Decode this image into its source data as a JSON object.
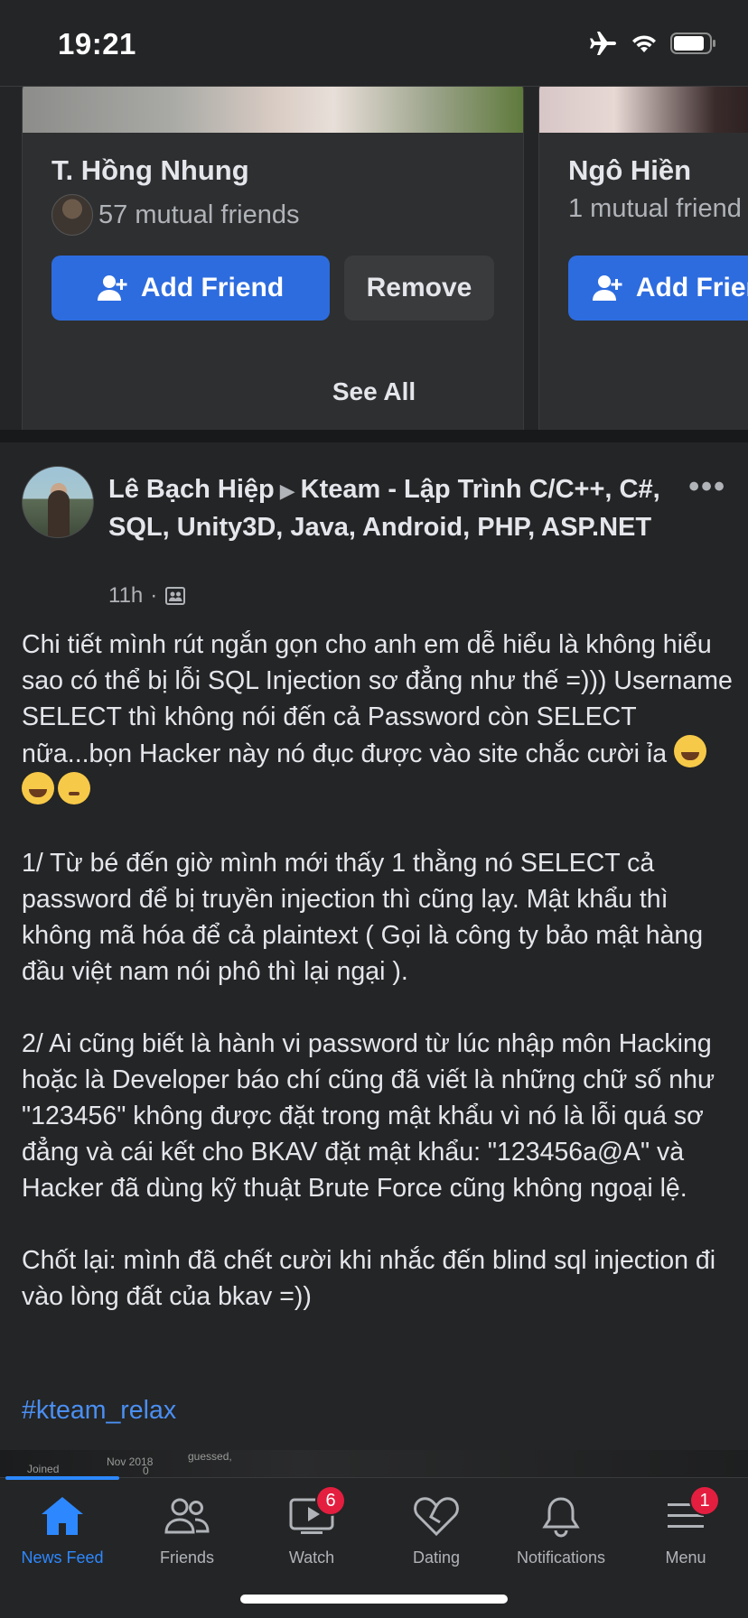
{
  "status_bar": {
    "time": "19:21"
  },
  "suggestions": {
    "cards": [
      {
        "name": "T. Hồng Nhung",
        "mutual": "57 mutual friends",
        "add_label": "Add Friend",
        "remove_label": "Remove"
      },
      {
        "name": "Ngô Hiền",
        "mutual": "1 mutual friend",
        "add_label": "Add Friend"
      }
    ],
    "see_all": "See All"
  },
  "post": {
    "author": "Lê Bạch Hiệp",
    "group": "Kteam - Lập Trình C/C++, C#, SQL, Unity3D, Java, Android, PHP, ASP.NET",
    "time": "11h",
    "more_icon": "more-dots-icon",
    "paragraphs": [
      "Chi tiết mình rút ngắn gọn cho anh em dễ hiểu là không hiểu sao có thể bị lỗi SQL Injection sơ đẳng như thế =))) Username SELECT thì không nói đến cả Password còn SELECT nữa...bọn Hacker này nó đục được vào site chắc cười ỉa",
      "1/ Từ bé đến giờ mình mới thấy 1 thằng nó SELECT cả password để bị truyền injection thì cũng lạy. Mật khẩu thì không mã hóa để cả plaintext ( Gọi là công ty bảo mật hàng đầu việt nam nói phô thì lại ngại ).",
      "2/ Ai cũng biết là hành vi password từ lúc nhập môn Hacking hoặc là Developer báo chí cũng đã viết là những chữ số như \"123456\" không được đặt trong mật khẩu vì nó là lỗi quá sơ đẳng và cái kết cho BKAV đặt mật khẩu: \"123456a@A\" và Hacker đã dùng kỹ thuật Brute Force cũng không ngoại lệ.",
      "Chốt lại: mình đã chết cười khi nhắc đến blind sql injection đi vào lòng đất của bkav =))"
    ],
    "hashtag": "#kteam_relax",
    "image_peek_texts": [
      "Joined",
      "Nov 2018",
      "guessed,",
      "0"
    ]
  },
  "tabbar": {
    "tabs": [
      {
        "label": "News Feed",
        "icon": "home-icon",
        "active": true
      },
      {
        "label": "Friends",
        "icon": "friends-icon"
      },
      {
        "label": "Watch",
        "icon": "watch-icon",
        "badge": "6"
      },
      {
        "label": "Dating",
        "icon": "dating-icon"
      },
      {
        "label": "Notifications",
        "icon": "bell-icon"
      },
      {
        "label": "Menu",
        "icon": "menu-icon",
        "badge": "1"
      }
    ]
  },
  "colors": {
    "accent": "#2d88ff",
    "button_blue": "#2d6cdf",
    "badge_red": "#e41e3f",
    "background": "#242526"
  }
}
